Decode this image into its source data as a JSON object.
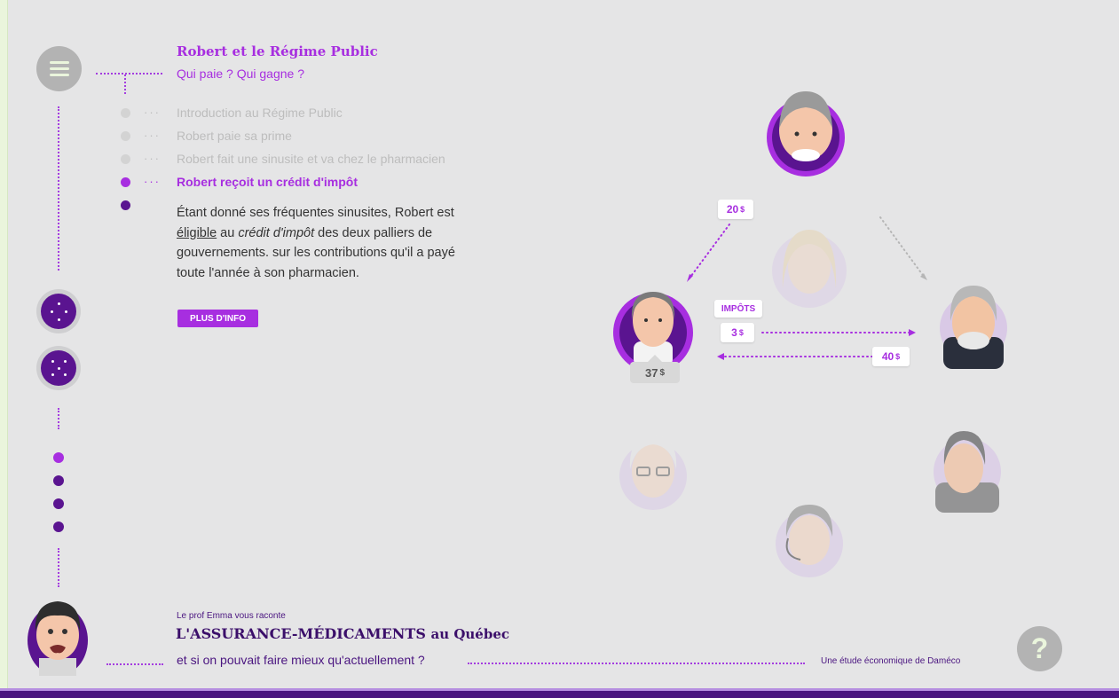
{
  "header": {
    "title": "Robert et le Régime Public",
    "subtitle": "Qui paie ? Qui gagne ?"
  },
  "steps": [
    {
      "label": "Introduction au Régime Public",
      "state": "done"
    },
    {
      "label": "Robert paie sa prime",
      "state": "done"
    },
    {
      "label": "Robert fait une sinusite et va chez le pharmacien",
      "state": "done"
    },
    {
      "label": "Robert reçoit un crédit d'impôt",
      "state": "active"
    }
  ],
  "paragraph": {
    "p1": "Étant donné ses fréquentes sinusites, Robert est ",
    "link": "éligible",
    "p2": " au ",
    "italic": "crédit d'impôt",
    "p3": " des deux palliers de gouvernements. sur les contributions qu'il a payé toute l'année à son pharmacien."
  },
  "info_button": "PLUS D'INFO",
  "diagram": {
    "tag_20": "20",
    "tag_impots": "IMPÔTS",
    "tag_3": "3",
    "tag_40": "40",
    "price": "37",
    "currency": "$"
  },
  "footer": {
    "kicker": "Le prof Emma vous raconte",
    "title_main": "L'ASSURANCE-MÉDICAMENTS",
    "title_suffix": "au Québec",
    "subtitle": "et si on pouvait faire mieux qu'actuellement ?",
    "credit": "Une étude économique de Daméco"
  },
  "help_symbol": "?",
  "colors": {
    "accent": "#a72ee0",
    "dark_purple": "#5a1490",
    "background": "#e5e5e6"
  }
}
